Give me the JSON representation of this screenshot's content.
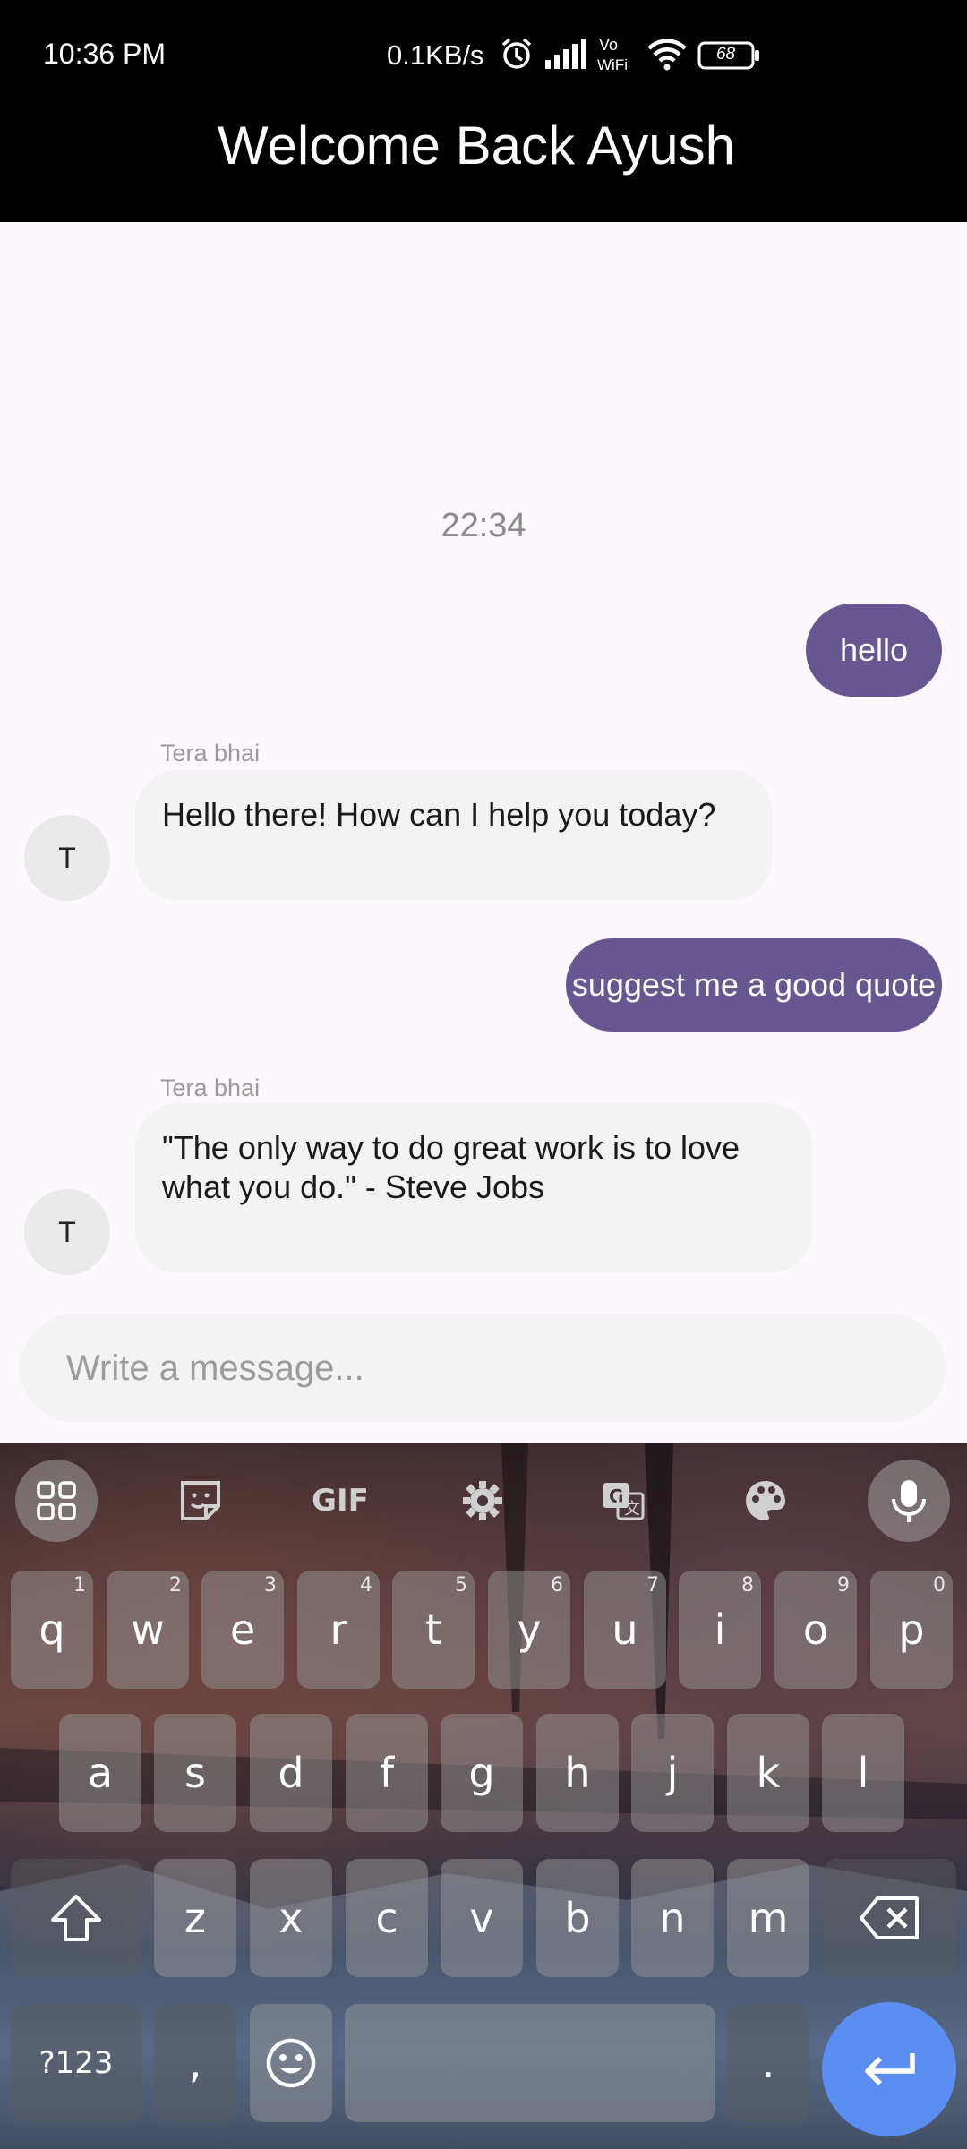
{
  "status_bar": {
    "time": "10:36 PM",
    "net_speed": "0.1KB/s",
    "battery": "68",
    "vowifi": "Vo WiFi"
  },
  "app_bar": {
    "title": "Welcome Back Ayush"
  },
  "chat": {
    "timestamp": "22:34",
    "messages": [
      {
        "side": "out",
        "text": "hello"
      },
      {
        "side": "in",
        "sender": "Tera bhai",
        "avatar": "T",
        "text": "Hello there! How can I help you today?"
      },
      {
        "side": "out",
        "text": "suggest me a good quote"
      },
      {
        "side": "in",
        "sender": "Tera bhai",
        "avatar": "T",
        "text": "\"The only way to do great work is to love what you do.\" - Steve Jobs"
      }
    ]
  },
  "composer": {
    "placeholder": "Write a message..."
  },
  "keyboard": {
    "toolbar": [
      "apps-grid-icon",
      "sticker-icon",
      "GIF",
      "gear-icon",
      "translate-icon",
      "palette-icon",
      "microphone-icon"
    ],
    "row1": [
      {
        "k": "q",
        "hint": "1"
      },
      {
        "k": "w",
        "hint": "2"
      },
      {
        "k": "e",
        "hint": "3"
      },
      {
        "k": "r",
        "hint": "4"
      },
      {
        "k": "t",
        "hint": "5"
      },
      {
        "k": "y",
        "hint": "6"
      },
      {
        "k": "u",
        "hint": "7"
      },
      {
        "k": "i",
        "hint": "8"
      },
      {
        "k": "o",
        "hint": "9"
      },
      {
        "k": "p",
        "hint": "0"
      }
    ],
    "row2": [
      "a",
      "s",
      "d",
      "f",
      "g",
      "h",
      "j",
      "k",
      "l"
    ],
    "row3": [
      "z",
      "x",
      "c",
      "v",
      "b",
      "n",
      "m"
    ],
    "symbols_label": "?123",
    "comma": ",",
    "period": "."
  }
}
